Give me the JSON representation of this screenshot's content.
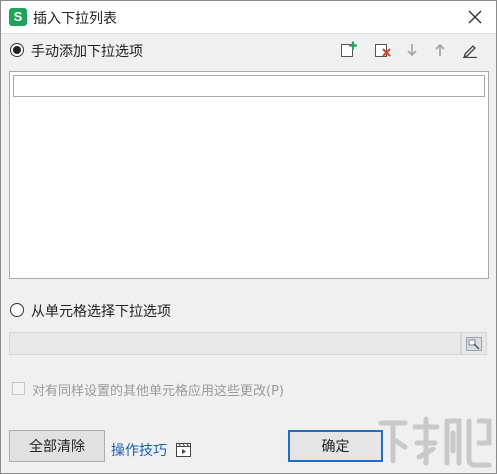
{
  "window": {
    "title": "插入下拉列表",
    "app_icon_letter": "S"
  },
  "manual": {
    "label": "手动添加下拉选项",
    "selected": true,
    "toolbar": [
      "add-item-icon",
      "delete-item-icon",
      "move-down-icon",
      "move-up-icon",
      "edit-icon"
    ],
    "items": [
      ""
    ]
  },
  "from_cells": {
    "label": "从单元格选择下拉选项",
    "selected": false,
    "range_value": ""
  },
  "apply_all": {
    "label": "对有同样设置的其他单元格应用这些更改(P)",
    "checked": false,
    "disabled": true
  },
  "footer": {
    "clear_all": "全部清除",
    "tips_link": "操作技巧",
    "ok": "确定"
  },
  "colors": {
    "accent_green": "#1fa25a",
    "link_blue": "#1a5fb4",
    "ok_border": "#1d6fbf",
    "delete_red": "#d93a3a"
  }
}
